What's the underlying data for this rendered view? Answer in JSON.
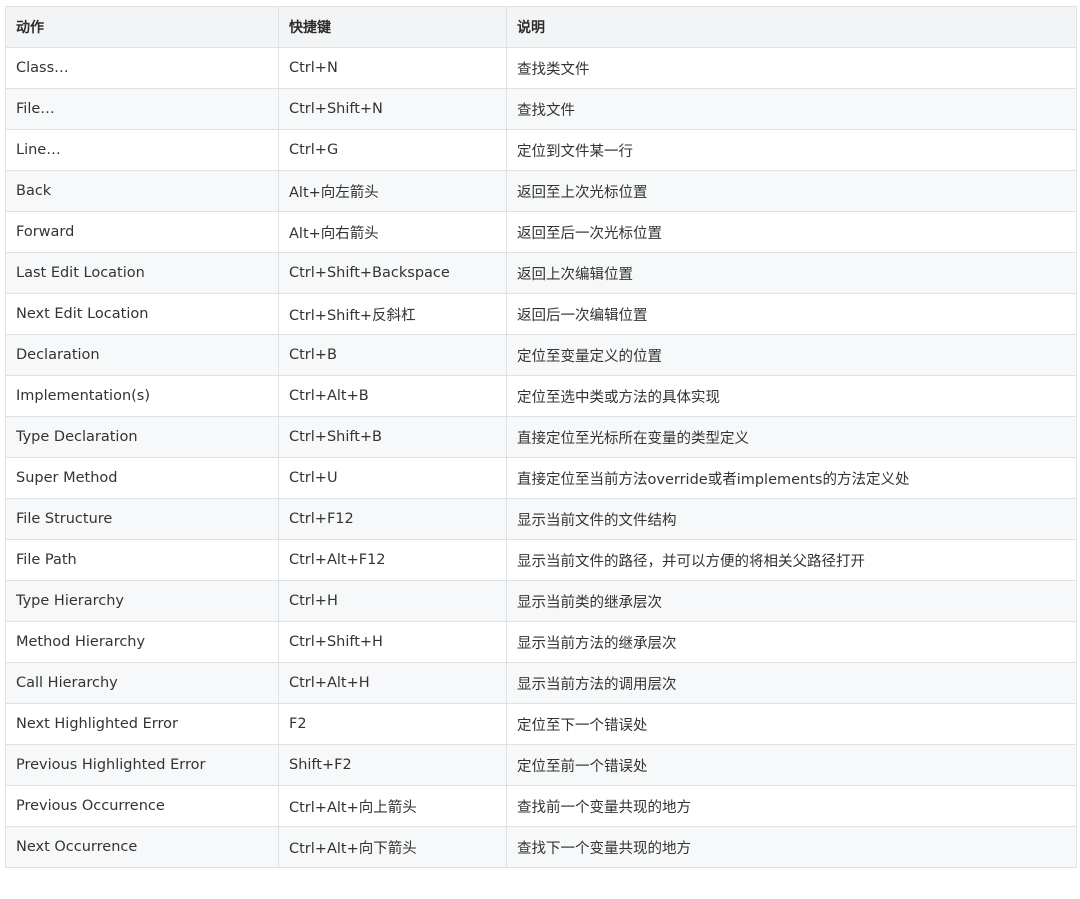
{
  "headers": [
    "动作",
    "快捷键",
    "说明"
  ],
  "rows": [
    [
      "Class…",
      "Ctrl+N",
      "查找类文件"
    ],
    [
      "File…",
      "Ctrl+Shift+N",
      "查找文件"
    ],
    [
      "Line…",
      "Ctrl+G",
      "定位到文件某一行"
    ],
    [
      "Back",
      "Alt+向左箭头",
      "返回至上次光标位置"
    ],
    [
      "Forward",
      "Alt+向右箭头",
      "返回至后一次光标位置"
    ],
    [
      "Last Edit Location",
      "Ctrl+Shift+Backspace",
      "返回上次编辑位置"
    ],
    [
      "Next Edit Location",
      "Ctrl+Shift+反斜杠",
      "返回后一次编辑位置"
    ],
    [
      "Declaration",
      "Ctrl+B",
      "定位至变量定义的位置"
    ],
    [
      "Implementation(s)",
      "Ctrl+Alt+B",
      "定位至选中类或方法的具体实现"
    ],
    [
      "Type Declaration",
      "Ctrl+Shift+B",
      "直接定位至光标所在变量的类型定义"
    ],
    [
      "Super Method",
      "Ctrl+U",
      "直接定位至当前方法override或者implements的方法定义处"
    ],
    [
      "File Structure",
      "Ctrl+F12",
      "显示当前文件的文件结构"
    ],
    [
      "File Path",
      "Ctrl+Alt+F12",
      "显示当前文件的路径，并可以方便的将相关父路径打开"
    ],
    [
      "Type Hierarchy",
      "Ctrl+H",
      "显示当前类的继承层次"
    ],
    [
      "Method Hierarchy",
      "Ctrl+Shift+H",
      "显示当前方法的继承层次"
    ],
    [
      "Call Hierarchy",
      "Ctrl+Alt+H",
      "显示当前方法的调用层次"
    ],
    [
      "Next Highlighted Error",
      "F2",
      "定位至下一个错误处"
    ],
    [
      "Previous Highlighted Error",
      "Shift+F2",
      "定位至前一个错误处"
    ],
    [
      "Previous Occurrence",
      "Ctrl+Alt+向上箭头",
      "查找前一个变量共现的地方"
    ],
    [
      "Next Occurrence",
      "Ctrl+Alt+向下箭头",
      "查找下一个变量共现的地方"
    ]
  ]
}
